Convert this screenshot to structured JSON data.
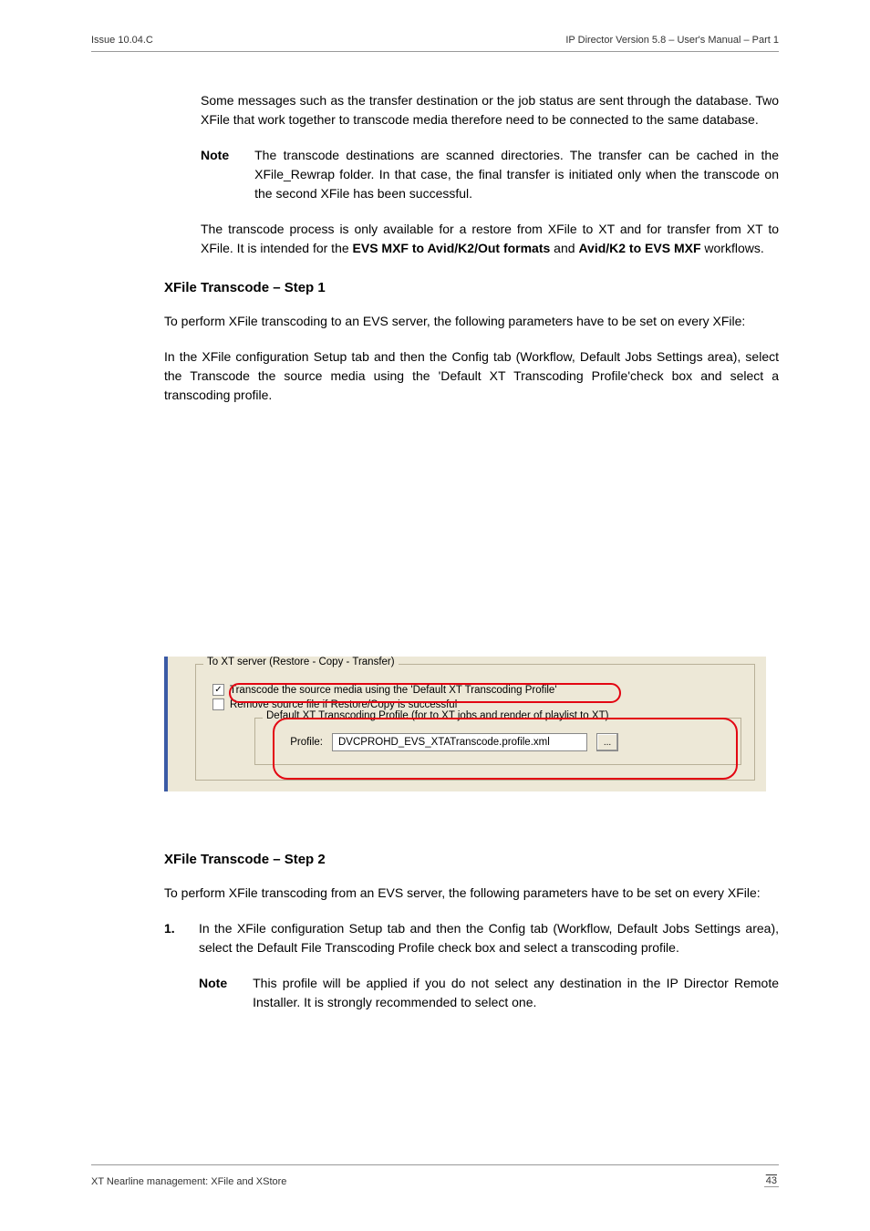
{
  "header": {
    "issue": "Issue 10.04.C",
    "product": "IP Director Version 5.8 – User's Manual – Part 1"
  },
  "body": {
    "p1": "Some messages such as the transfer destination or the job status are sent through the database. Two XFile that work together to transcode media therefore need to be connected to the same database.",
    "note1_label": "Note",
    "note1": "The transcode destinations are scanned directories. The transfer can be cached in the XFile_Rewrap folder. In that case, the final transfer is initiated only when the transcode on the second XFile has been successful.",
    "p2a": "The transcode process is only available for a restore from XFile to XT and for transfer from XT to XFile. It is intended for the ",
    "p2b": "EVS MXF to Avid/K2/Out formats",
    "p2c": " and ",
    "p2d": "Avid/K2 to EVS MXF",
    "p2e": " workflows.",
    "s1_title": "XFile Transcode – Step 1",
    "s1_1": "To perform XFile transcoding to an EVS server, the following parameters have to be set on every XFile:",
    "s1_2": "In the XFile configuration Setup tab and then the Config tab (Workflow, Default Jobs Settings area), select the Transcode the source media using the 'Default XT Transcoding Profile'check box and select a transcoding profile.",
    "fs_title": "To XT server (Restore - Copy - Transfer)",
    "chk1": "Transcode the source media using the 'Default XT Transcoding Profile'",
    "chk2": "Remove source file if Restore/Copy is successful",
    "fs_inner": "Default XT Transcoding Profile (for to XT jobs and render of playlist to XT)",
    "profile_label": "Profile:",
    "profile_value": "DVCPROHD_EVS_XTATranscode.profile.xml",
    "browse": "...",
    "s2_title": "XFile Transcode – Step 2",
    "s2_1": "To perform XFile transcoding from an EVS server, the following parameters have to be set on every XFile:",
    "s2_2_label": "1.",
    "s2_2": "In the XFile configuration Setup tab and then the Config tab (Workflow, Default Jobs Settings area), select the Default File Transcoding Profile check box and select a transcoding profile.",
    "note2_label": "Note",
    "note2": "This profile will be applied if you do not select any destination in the IP Director Remote Installer. It is strongly recommended to select one."
  },
  "footer": {
    "left": "XT Nearline management: XFile and XStore",
    "right": "43"
  }
}
